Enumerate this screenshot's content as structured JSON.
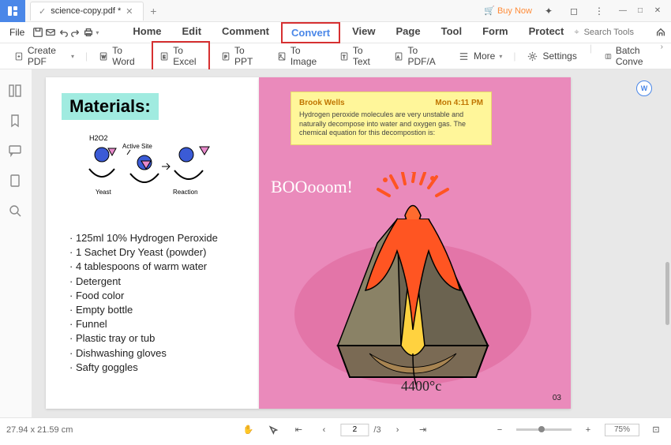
{
  "titlebar": {
    "filename": "science-copy.pdf *",
    "buy_now": "Buy Now"
  },
  "menubar": {
    "file": "File",
    "items": [
      "Home",
      "Edit",
      "Comment",
      "Convert",
      "View",
      "Page",
      "Tool",
      "Form",
      "Protect"
    ],
    "search_placeholder": "Search Tools"
  },
  "toolbar": {
    "create_pdf": "Create PDF",
    "to_word": "To Word",
    "to_excel": "To Excel",
    "to_ppt": "To PPT",
    "to_image": "To Image",
    "to_text": "To Text",
    "to_pdfa": "To PDF/A",
    "more": "More",
    "settings": "Settings",
    "batch": "Batch Conve"
  },
  "document": {
    "materials_heading": "Materials:",
    "diagram_labels": {
      "h2o2": "H2O2",
      "active_site": "Active Site",
      "yeast": "Yeast",
      "reaction": "Reaction"
    },
    "materials_items": [
      "· 125ml 10% Hydrogen Peroxide",
      "· 1 Sachet Dry Yeast (powder)",
      "· 4 tablespoons of warm water",
      "· Detergent",
      "· Food color",
      "· Empty bottle",
      "· Funnel",
      "· Plastic tray or tub",
      "· Dishwashing gloves",
      "· Safty goggles"
    ],
    "note": {
      "author": "Brook Wells",
      "time": "Mon 4:11 PM",
      "body": "Hydrogen peroxide molecules are very unstable and naturally decompose into water and oxygen gas. The chemical equation for this decompostion is:"
    },
    "boom": "BOOooom!",
    "temperature": "4400°c",
    "page_num": "03"
  },
  "statusbar": {
    "dimensions": "27.94 x 21.59 cm",
    "page": "2",
    "total": "/3",
    "zoom": "75%"
  }
}
